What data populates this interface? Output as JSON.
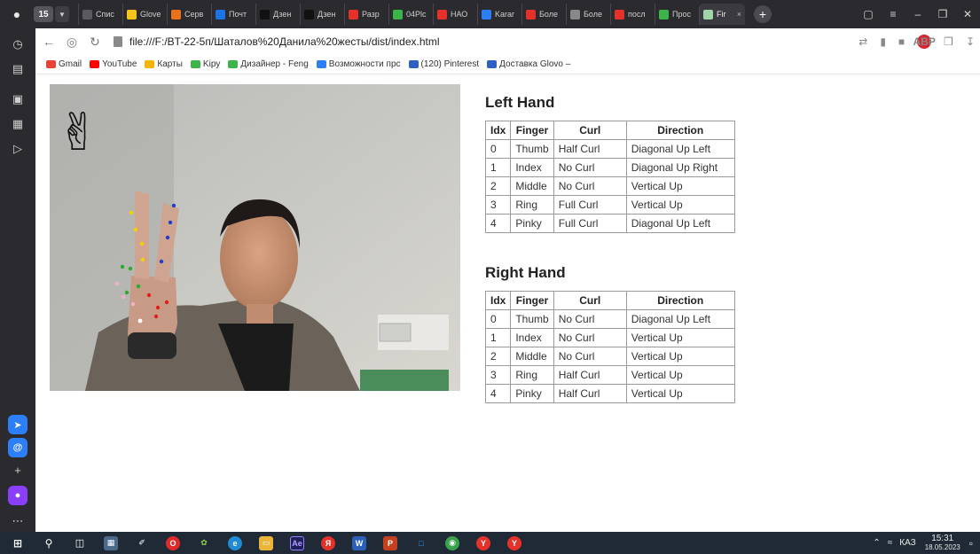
{
  "browser": {
    "tab_count": "15",
    "tabs": [
      {
        "label": "Спис",
        "color": "#5a5a60"
      },
      {
        "label": "Glove",
        "color": "#f5c518"
      },
      {
        "label": "Серв",
        "color": "#e8731c"
      },
      {
        "label": "Почт",
        "color": "#1a73e8"
      },
      {
        "label": "Дзен",
        "color": "#111111"
      },
      {
        "label": "Дзен",
        "color": "#111111"
      },
      {
        "label": "Разр",
        "color": "#e6312b"
      },
      {
        "label": "04Plc",
        "color": "#3bb54a"
      },
      {
        "label": "НАО",
        "color": "#e6312b"
      },
      {
        "label": "Karar",
        "color": "#2d7ff9"
      },
      {
        "label": "Боле",
        "color": "#e6312b"
      },
      {
        "label": "Боле",
        "color": "#888888"
      },
      {
        "label": "посл",
        "color": "#e6312b"
      },
      {
        "label": "Прос",
        "color": "#3bb54a"
      }
    ],
    "active_tab": {
      "label": "Fir",
      "close": "×"
    },
    "new_tab": "+",
    "url": "file:///F:/BT-22-5п/Шаталов%20Данила%20жесты/dist/index.html"
  },
  "bookmarks": [
    {
      "label": "Gmail",
      "color": "#ea4335"
    },
    {
      "label": "YouTube",
      "color": "#ff0000"
    },
    {
      "label": "Карты",
      "color": "#f4b400"
    },
    {
      "label": "Kipy",
      "color": "#3bb54a"
    },
    {
      "label": "Дизайнер - Feng",
      "color": "#3bb54a"
    },
    {
      "label": "Возможности прс",
      "color": "#2d7ff9"
    },
    {
      "label": "(120) Pinterest",
      "color": "#2d62c4"
    },
    {
      "label": "Доставка Glovo –",
      "color": "#2d62c4"
    }
  ],
  "left_hand": {
    "title": "Left Hand",
    "headers": [
      "Idx",
      "Finger",
      "Curl",
      "Direction"
    ],
    "rows": [
      [
        "0",
        "Thumb",
        "Half Curl",
        "Diagonal Up Left"
      ],
      [
        "1",
        "Index",
        "No Curl",
        "Diagonal Up Right"
      ],
      [
        "2",
        "Middle",
        "No Curl",
        "Vertical Up"
      ],
      [
        "3",
        "Ring",
        "Full Curl",
        "Vertical Up"
      ],
      [
        "4",
        "Pinky",
        "Full Curl",
        "Diagonal Up Left"
      ]
    ]
  },
  "right_hand": {
    "title": "Right Hand",
    "headers": [
      "Idx",
      "Finger",
      "Curl",
      "Direction"
    ],
    "rows": [
      [
        "0",
        "Thumb",
        "No Curl",
        "Diagonal Up Left"
      ],
      [
        "1",
        "Index",
        "No Curl",
        "Vertical Up"
      ],
      [
        "2",
        "Middle",
        "No Curl",
        "Vertical Up"
      ],
      [
        "3",
        "Ring",
        "Half Curl",
        "Vertical Up"
      ],
      [
        "4",
        "Pinky",
        "Half Curl",
        "Vertical Up"
      ]
    ]
  },
  "gesture_emoji": "✌",
  "taskbar": {
    "lang": "КАЗ",
    "time": "15:31",
    "date": "18.05.2023"
  }
}
